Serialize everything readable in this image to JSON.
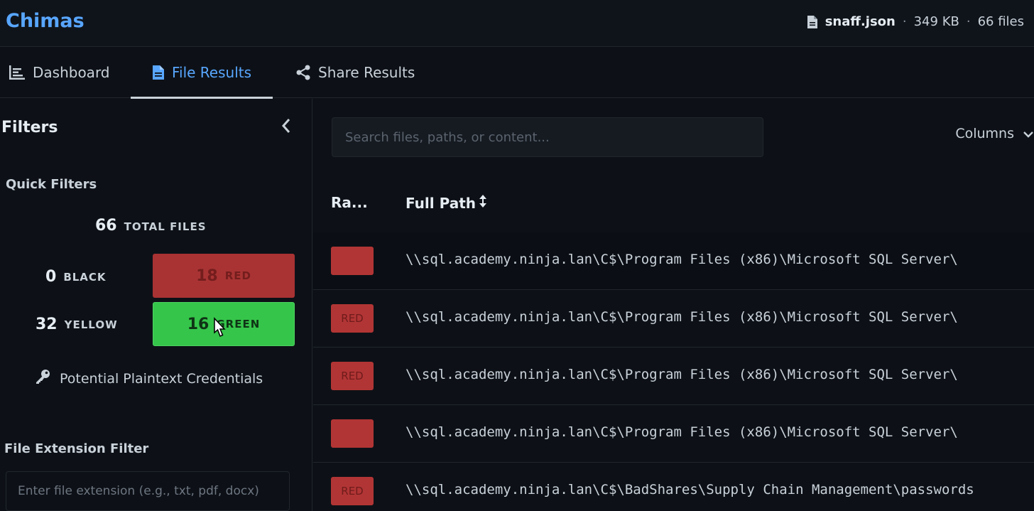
{
  "app": {
    "title": "Chimas"
  },
  "file": {
    "name": "snaff.json",
    "size": "349 KB",
    "count": "66 files",
    "separator": "·"
  },
  "tabs": [
    {
      "label": "Dashboard",
      "icon": "chart-icon"
    },
    {
      "label": "File Results",
      "icon": "file-icon",
      "active": true
    },
    {
      "label": "Share Results",
      "icon": "share-icon"
    }
  ],
  "sidebar": {
    "title": "Filters",
    "quick_filters_title": "Quick Filters",
    "total": {
      "value": "66",
      "label": "TOTAL FILES"
    },
    "black": {
      "value": "0",
      "label": "BLACK"
    },
    "yellow": {
      "value": "32",
      "label": "YELLOW"
    },
    "red": {
      "value": "18",
      "label": "RED"
    },
    "green": {
      "value": "16",
      "label": "GREEN"
    },
    "credentials_label": "Potential Plaintext Credentials",
    "ext_filter_title": "File Extension Filter",
    "ext_placeholder": "Enter file extension (e.g., txt, pdf, docx)"
  },
  "main": {
    "search_placeholder": "Search files, paths, or content...",
    "columns_label": "Columns",
    "headers": {
      "rating": "Ra...",
      "path": "Full Path"
    },
    "rows": [
      {
        "rating": "",
        "path": "\\\\sql.academy.ninja.lan\\C$\\Program Files (x86)\\Microsoft SQL Server\\"
      },
      {
        "rating": "RED",
        "path": "\\\\sql.academy.ninja.lan\\C$\\Program Files (x86)\\Microsoft SQL Server\\"
      },
      {
        "rating": "RED",
        "path": "\\\\sql.academy.ninja.lan\\C$\\Program Files (x86)\\Microsoft SQL Server\\"
      },
      {
        "rating": "",
        "path": "\\\\sql.academy.ninja.lan\\C$\\Program Files (x86)\\Microsoft SQL Server\\"
      },
      {
        "rating": "RED",
        "path": "\\\\sql.academy.ninja.lan\\C$\\BadShares\\Supply Chain Management\\passwords"
      }
    ]
  },
  "colors": {
    "accent": "#58a6ff",
    "red_badge": "#b23535",
    "green_pill": "#35c54a",
    "background": "#0d1117"
  }
}
